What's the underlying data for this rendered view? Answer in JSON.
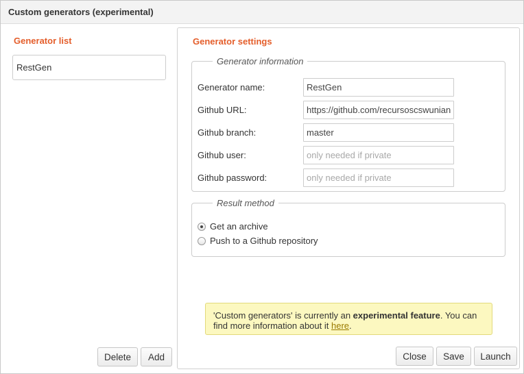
{
  "dialog": {
    "title": "Custom generators (experimental)"
  },
  "left": {
    "title": "Generator list",
    "items": [
      "RestGen"
    ],
    "delete_label": "Delete",
    "add_label": "Add"
  },
  "right": {
    "title": "Generator settings",
    "info": {
      "legend": "Generator information",
      "fields": [
        {
          "label": "Generator name:",
          "value": "RestGen",
          "placeholder": ""
        },
        {
          "label": "Github URL:",
          "value": "https://github.com/recursoscswunian",
          "placeholder": ""
        },
        {
          "label": "Github branch:",
          "value": "master",
          "placeholder": ""
        },
        {
          "label": "Github user:",
          "value": "",
          "placeholder": "only needed if private"
        },
        {
          "label": "Github password:",
          "value": "",
          "placeholder": "only needed if private"
        }
      ]
    },
    "result": {
      "legend": "Result method",
      "options": [
        {
          "label": "Get an archive",
          "checked": true
        },
        {
          "label": "Push to a Github repository",
          "checked": false
        }
      ]
    },
    "notice": {
      "pre": "'Custom generators' is currently an ",
      "bold": "experimental feature",
      "mid": ". You can find more information about it ",
      "link": "here",
      "post": "."
    },
    "close_label": "Close",
    "save_label": "Save",
    "launch_label": "Launch"
  },
  "colors": {
    "accent": "#e45d2a",
    "notice_bg": "#fcf8c0",
    "notice_border": "#e2d97a"
  }
}
